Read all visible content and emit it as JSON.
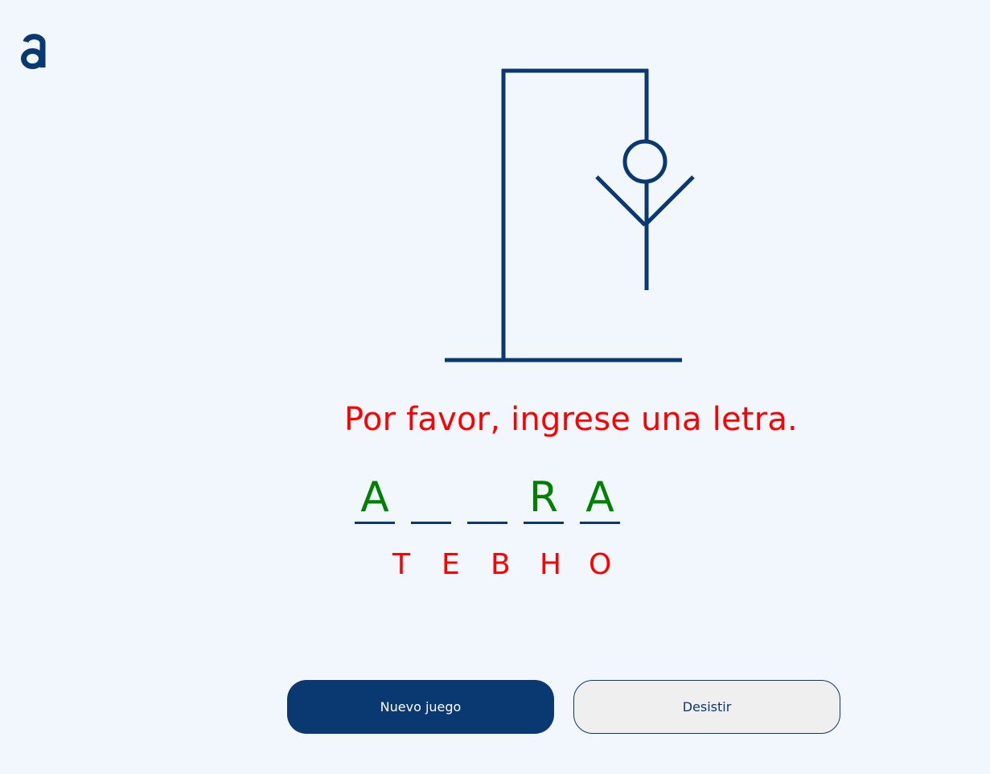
{
  "colors": {
    "background": "#f2f6fd",
    "brand": "#0a3871",
    "correct": "#008000",
    "error": "#ff0000",
    "secondary_button_bg": "#efefef"
  },
  "logo": {
    "name": "alura-logo-icon"
  },
  "hangman": {
    "parts_shown": [
      "base",
      "post",
      "beam",
      "rope",
      "head",
      "body",
      "left-arm",
      "right-arm"
    ]
  },
  "game": {
    "message": "Por favor, ingrese una letra.",
    "word_slots": [
      "A",
      "",
      "",
      "R",
      "A"
    ],
    "wrong_letters": [
      "T",
      "E",
      "B",
      "H",
      "O"
    ]
  },
  "buttons": {
    "new_game": "Nuevo juego",
    "give_up": "Desistir"
  }
}
